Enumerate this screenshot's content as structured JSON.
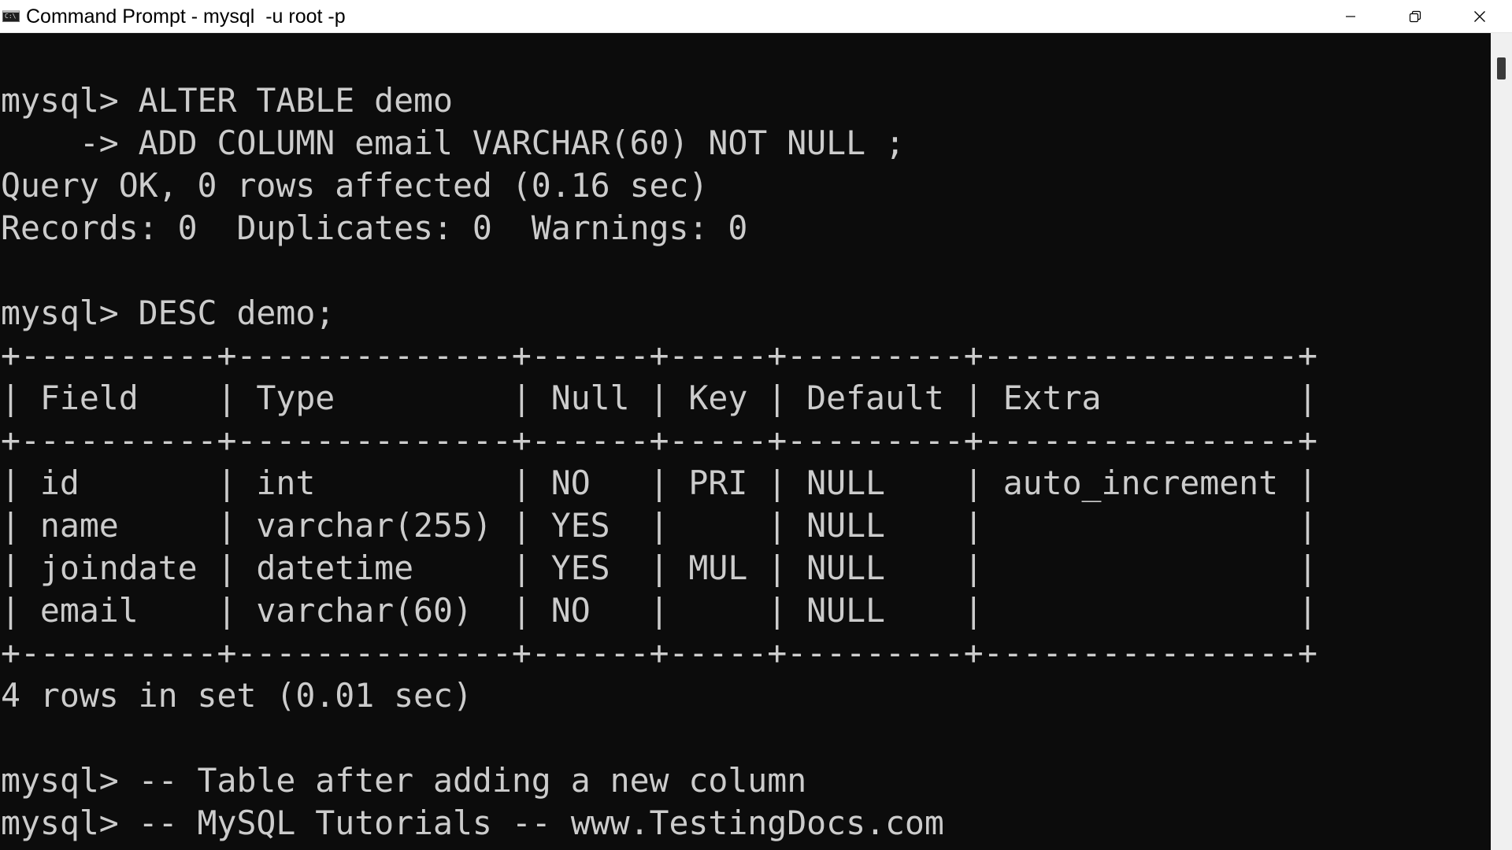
{
  "window": {
    "title": "Command Prompt - mysql  -u root -p",
    "icon": "command-prompt-icon",
    "icon_glyph": "C:\\",
    "controls": {
      "minimize": "minimize-icon",
      "restore": "restore-icon",
      "close": "close-icon"
    }
  },
  "console": {
    "lines": [
      "mysql> ALTER TABLE demo",
      "    -> ADD COLUMN email VARCHAR(60) NOT NULL ;",
      "Query OK, 0 rows affected (0.16 sec)",
      "Records: 0  Duplicates: 0  Warnings: 0",
      "",
      "mysql> DESC demo;",
      "+----------+--------------+------+-----+---------+----------------+",
      "| Field    | Type         | Null | Key | Default | Extra          |",
      "+----------+--------------+------+-----+---------+----------------+",
      "| id       | int          | NO   | PRI | NULL    | auto_increment |",
      "| name     | varchar(255) | YES  |     | NULL    |                |",
      "| joindate | datetime     | YES  | MUL | NULL    |                |",
      "| email    | varchar(60)  | NO   |     | NULL    |                |",
      "+----------+--------------+------+-----+---------+----------------+",
      "4 rows in set (0.01 sec)",
      "",
      "mysql> -- Table after adding a new column",
      "mysql> -- MySQL Tutorials -- www.TestingDocs.com"
    ]
  },
  "colors": {
    "console_bg": "#0c0c0c",
    "console_fg": "#cccccc",
    "titlebar_bg": "#ffffff"
  }
}
